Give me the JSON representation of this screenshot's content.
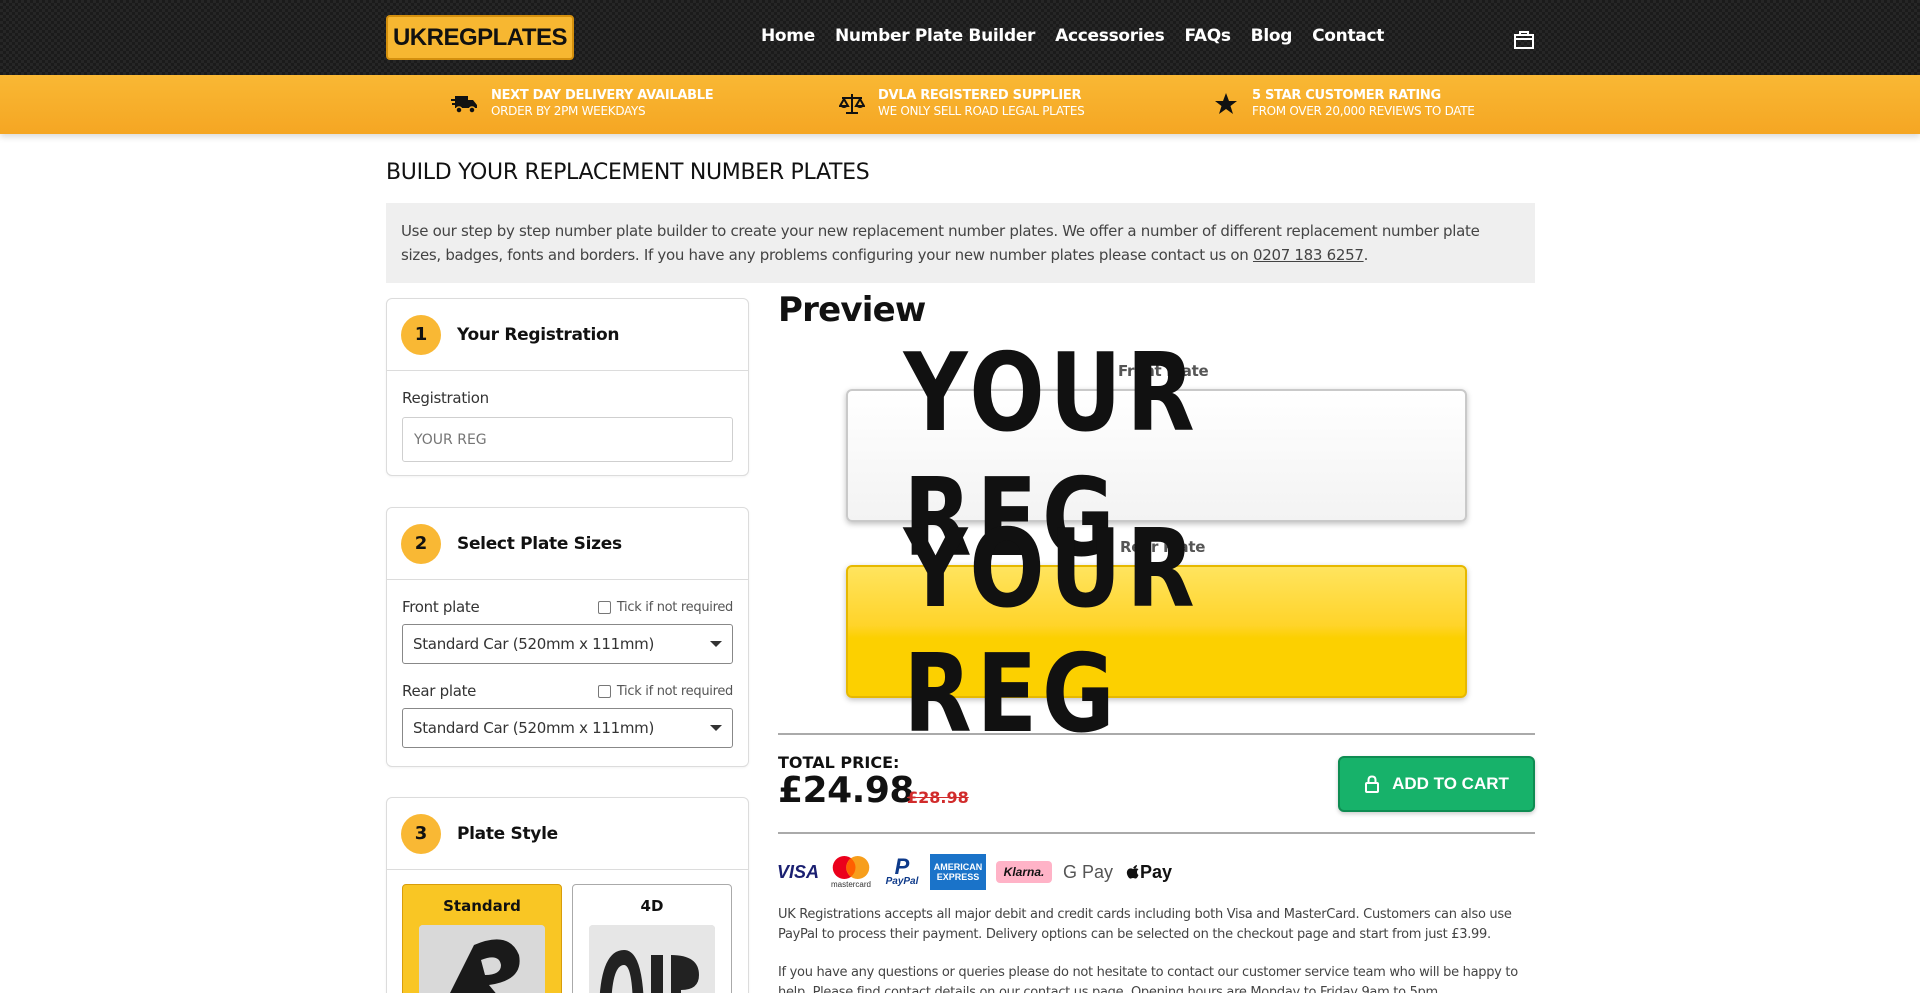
{
  "header": {
    "logo": "UKREGPLATES",
    "nav": [
      "Home",
      "Number Plate Builder",
      "Accessories",
      "FAQs",
      "Blog",
      "Contact"
    ]
  },
  "usp": [
    {
      "icon": "truck-icon",
      "title": "NEXT DAY DELIVERY AVAILABLE",
      "sub": "ORDER BY 2PM WEEKDAYS"
    },
    {
      "icon": "scales-icon",
      "title": "DVLA REGISTERED SUPPLIER",
      "sub": "WE ONLY SELL ROAD LEGAL PLATES"
    },
    {
      "icon": "star-icon",
      "title": "5 STAR CUSTOMER RATING",
      "sub": "FROM OVER 20,000 REVIEWS TO DATE"
    }
  ],
  "page": {
    "title": "BUILD YOUR REPLACEMENT NUMBER PLATES",
    "intro": "Use our step by step number plate builder to create your new replacement number plates. We offer a number of different replacement number plate sizes, badges, fonts and borders. If you have any problems configuring your new number plates please contact us on ",
    "phone": "0207 183 6257",
    "intro_end": "."
  },
  "steps": {
    "s1": {
      "num": "1",
      "title": "Your Registration",
      "label": "Registration",
      "placeholder": "YOUR REG"
    },
    "s2": {
      "num": "2",
      "title": "Select Plate Sizes",
      "front_label": "Front plate",
      "rear_label": "Rear plate",
      "tick_label": "Tick if not required",
      "front_value": "Standard Car (520mm x 111mm)",
      "rear_value": "Standard Car (520mm x 111mm)"
    },
    "s3": {
      "num": "3",
      "title": "Plate Style",
      "options": [
        "Standard",
        "4D"
      ]
    }
  },
  "preview": {
    "title": "Preview",
    "front_label": "Front Plate",
    "rear_label": "Rear Plate",
    "plate_text": "YOUR REG"
  },
  "pricing": {
    "total_label": "TOTAL PRICE:",
    "price": "£24.98",
    "old_price": "£28.98",
    "add_to_cart": "ADD TO CART"
  },
  "payments": {
    "visa": "VISA",
    "mastercard": "mastercard",
    "paypal": "PayPal",
    "amex": "AMERICAN EXPRESS",
    "klarna": "Klarna.",
    "gpay": "G Pay",
    "applepay": "Pay"
  },
  "info": {
    "p1": "UK Registrations accepts all major debit and credit cards including both Visa and MasterCard. Customers can also use PayPal to process their payment. Delivery options can be selected on the checkout page and start from just £3.99.",
    "p2_start": "If you have any questions or queries please do not hesitate to contact our customer service team who will be happy to help. Please find contact details on our ",
    "p2_link": "contact us",
    "p2_end": " page. Opening hours are Monday to Friday 9am to 5pm."
  },
  "colors": {
    "accent": "#f9b834",
    "cta": "#17b26a",
    "plate_yellow": "#fcd000"
  }
}
